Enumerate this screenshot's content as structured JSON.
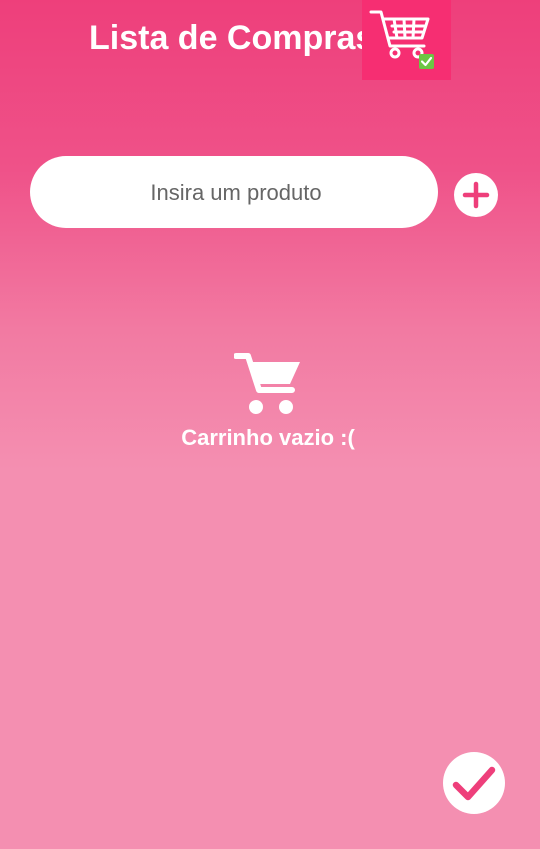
{
  "header": {
    "title": "Lista de Compras",
    "logo_icon": "shopping-cart-check-icon"
  },
  "input": {
    "placeholder": "Insira um produto",
    "value": ""
  },
  "add_button": {
    "icon": "plus-icon"
  },
  "empty_state": {
    "icon": "cart-icon",
    "message": "Carrinho vazio :("
  },
  "done_button": {
    "icon": "checkmark-icon"
  },
  "colors": {
    "accent": "#f62e72",
    "background_top": "#ee3f7b",
    "background_bottom": "#f48fb1",
    "check_green": "#6cc644"
  }
}
